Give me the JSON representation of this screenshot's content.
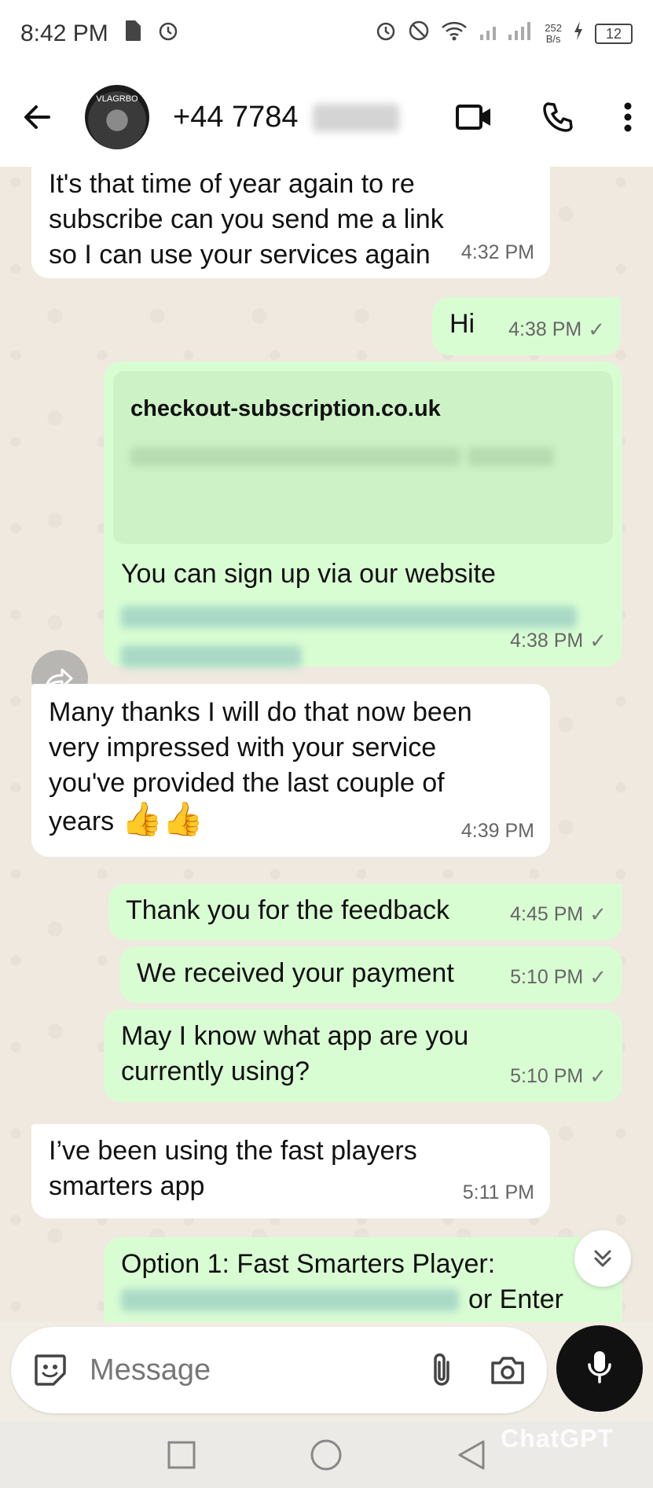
{
  "status_bar": {
    "time": "8:42 PM",
    "net_speed_value": "252",
    "net_speed_unit": "B/s",
    "battery": "12"
  },
  "header": {
    "avatar_text": "VLAGRBO",
    "contact_number": "+44 7784"
  },
  "messages": [
    {
      "direction": "incoming",
      "text": "It's that time of year again to re subscribe can you send me a link so I can use your services again",
      "time": "4:32 PM"
    },
    {
      "direction": "outgoing",
      "text": "Hi",
      "time": "4:38 PM"
    },
    {
      "direction": "outgoing",
      "link_title": "checkout-subscription.co.uk",
      "text": "You can sign up via our website",
      "time": "4:38 PM"
    },
    {
      "direction": "incoming",
      "text": "Many thanks I will do that now been very impressed with your service you've provided the last  couple of years",
      "emoji": "👍👍",
      "time": "4:39 PM"
    },
    {
      "direction": "outgoing",
      "text": "Thank you for the feedback",
      "time": "4:45 PM"
    },
    {
      "direction": "outgoing",
      "text": "We received your payment",
      "time": "5:10 PM"
    },
    {
      "direction": "outgoing",
      "text": "May I know what app are you currently using?",
      "time": "5:10 PM"
    },
    {
      "direction": "incoming",
      "text": "I’ve been using the fast players smarters app",
      "time": "5:11 PM"
    },
    {
      "direction": "outgoing",
      "text": "Option 1: Fast Smarters Player:",
      "text_tail": "or Enter"
    }
  ],
  "composer": {
    "placeholder": "Message"
  },
  "watermark": "ChatGPT",
  "colors": {
    "outgoing_bubble": "#d9fdd3",
    "incoming_bubble": "#ffffff",
    "chat_background": "#efe9df"
  }
}
